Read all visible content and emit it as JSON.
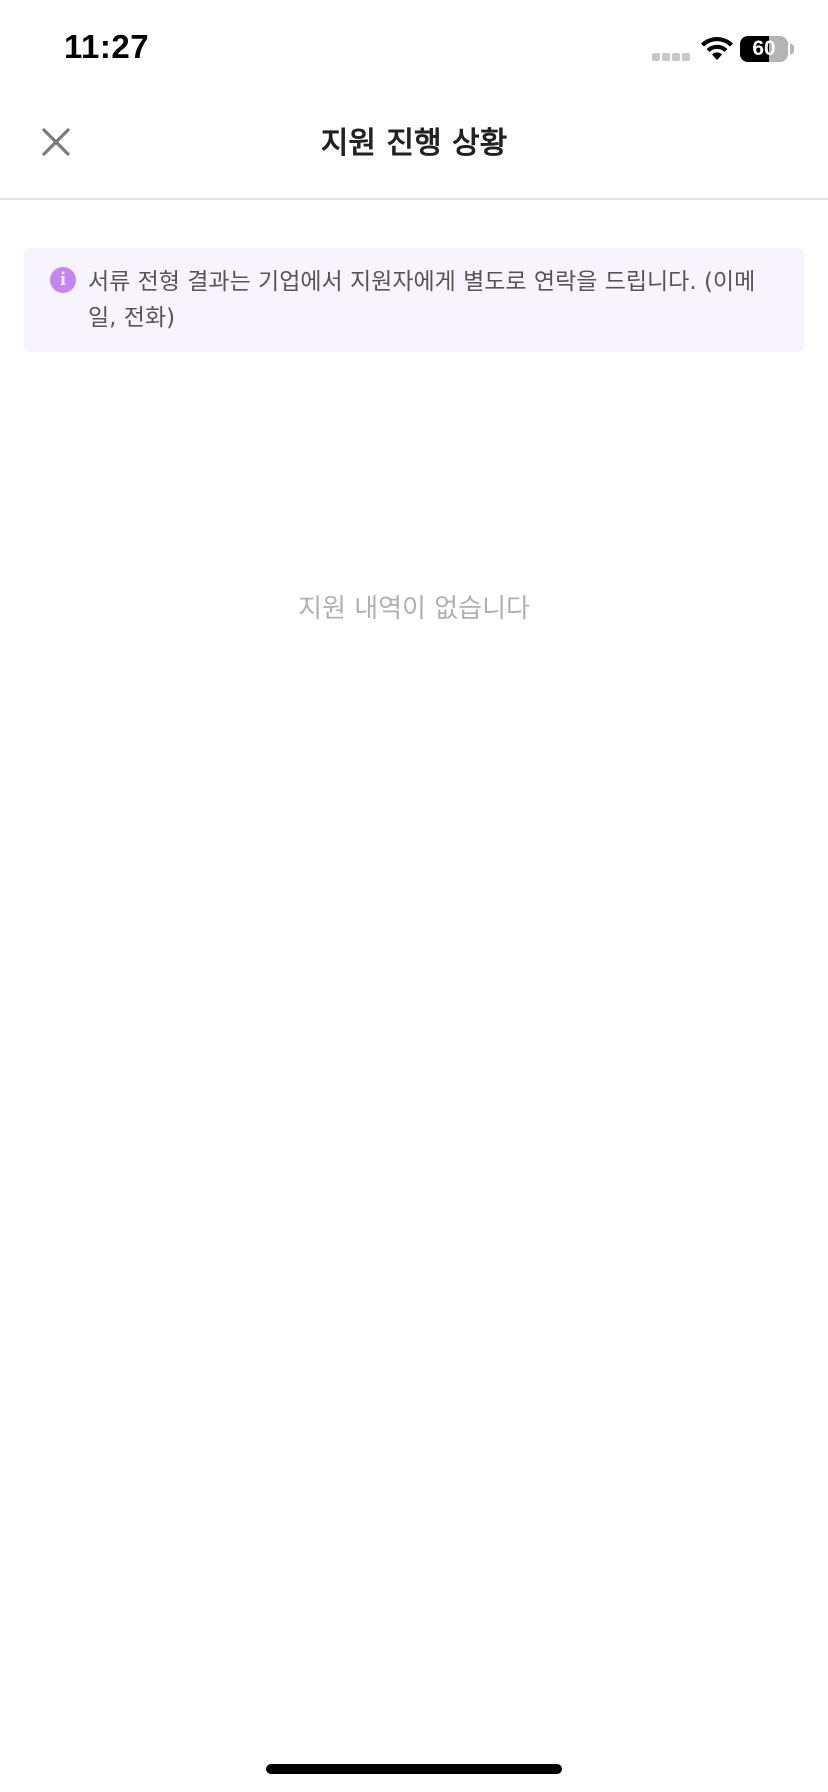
{
  "status_bar": {
    "time": "11:27",
    "battery_level": "60",
    "battery_fraction": 0.6,
    "signal_icon": "cellular-signal-icon",
    "wifi_icon": "wifi-icon",
    "battery_icon": "battery-icon"
  },
  "header": {
    "title": "지원 진행 상황",
    "close_icon": "close-icon"
  },
  "notice": {
    "icon": "info-icon",
    "icon_glyph": "i",
    "text": "서류 전형 결과는 기업에서 지원자에게 별도로 연락을 드립니다. (이메일, 전화)"
  },
  "empty_state": {
    "message": "지원 내역이 없습니다"
  },
  "colors": {
    "accent": "#c486f5",
    "notice_background": "#f8f4fd",
    "muted_text": "#b0b0b0"
  }
}
